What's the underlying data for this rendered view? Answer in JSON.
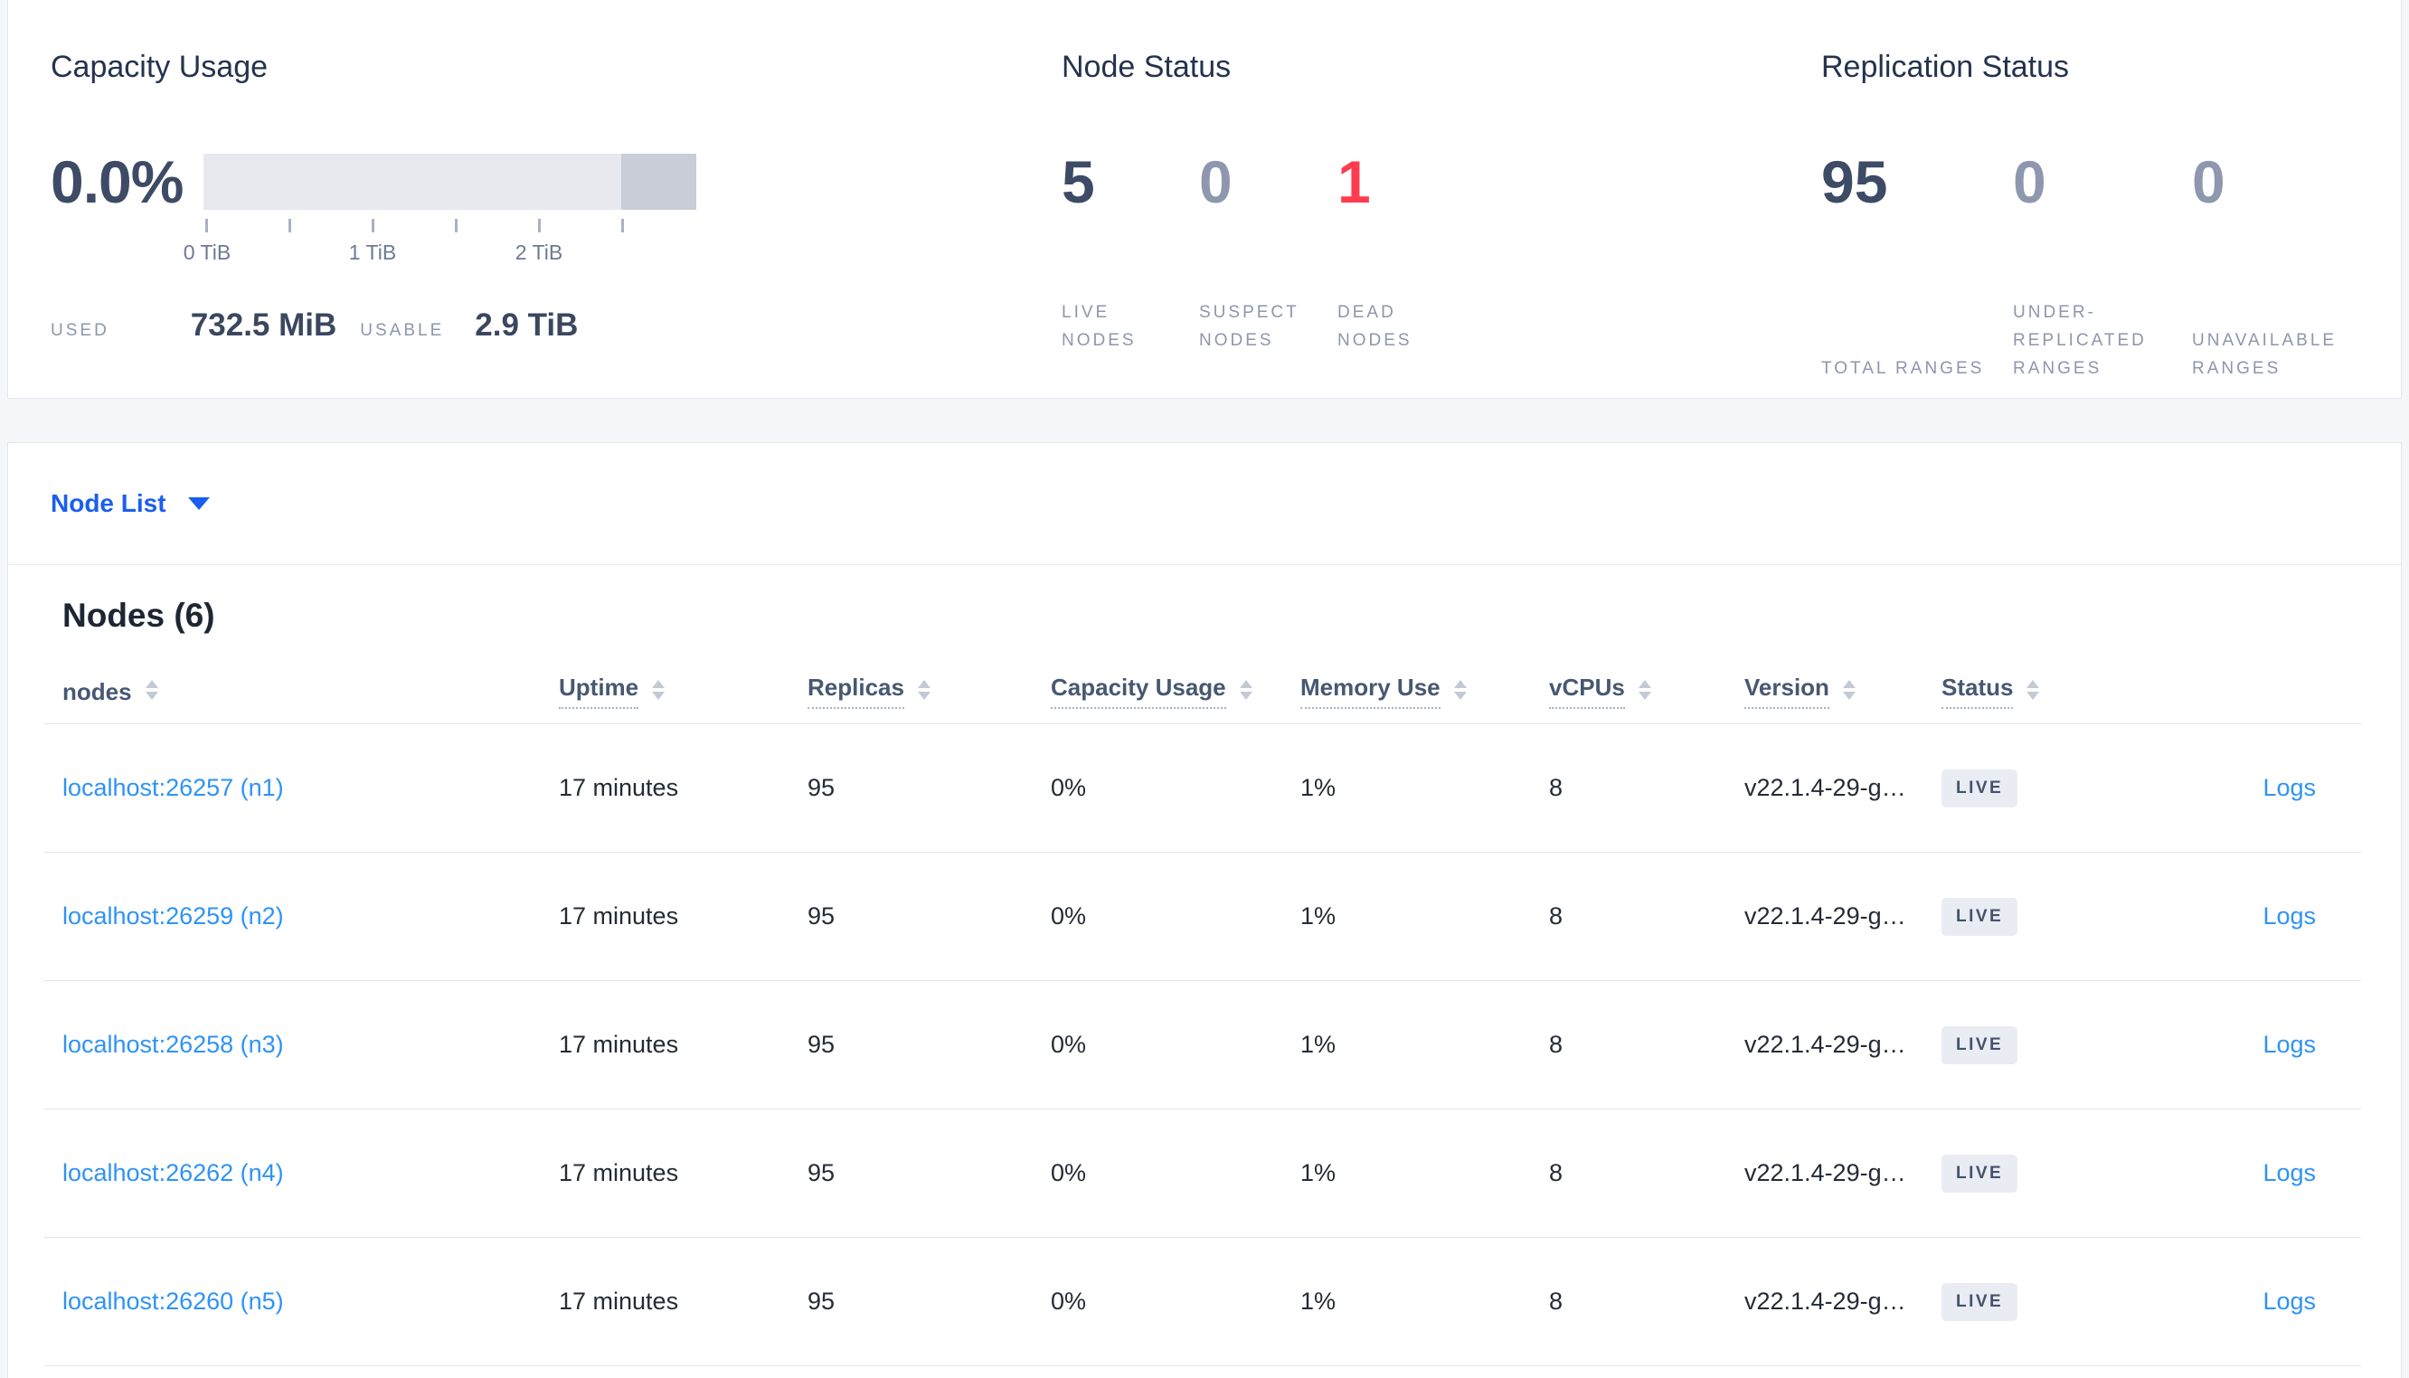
{
  "colors": {
    "page_background": "#f4f6fa",
    "card_background": "#ffffff",
    "accent_blue": "#1a5ef0",
    "link_blue": "#2e93f5",
    "danger_red": "#ff3b4f",
    "stat_dark": "#3e4b66",
    "stat_muted": "#8e97ad",
    "label_gray": "#8d96ac",
    "bar_light": "#e7e9ef",
    "bar_dark": "#c9cdd8"
  },
  "capacity_panel": {
    "title": "Capacity Usage",
    "percent": "0.0%",
    "tick_labels": [
      "0 TiB",
      "1 TiB",
      "2 TiB"
    ],
    "used_label": "USED",
    "used_value": "732.5 MiB",
    "usable_label": "USABLE",
    "usable_value": "2.9 TiB"
  },
  "node_status_panel": {
    "title": "Node Status",
    "live": {
      "value": "5",
      "label": "LIVE NODES"
    },
    "suspect": {
      "value": "0",
      "label": "SUSPECT NODES"
    },
    "dead": {
      "value": "1",
      "label": "DEAD NODES"
    }
  },
  "replication_panel": {
    "title": "Replication Status",
    "total": {
      "value": "95",
      "label": "TOTAL RANGES"
    },
    "under_replicated": {
      "value": "0",
      "label": "UNDER-REPLICATED RANGES"
    },
    "unavailable": {
      "value": "0",
      "label": "UNAVAILABLE RANGES"
    }
  },
  "view_selector": {
    "label": "Node List"
  },
  "nodes_section": {
    "title": "Nodes (6)",
    "columns": [
      "nodes",
      "Uptime",
      "Replicas",
      "Capacity Usage",
      "Memory Use",
      "vCPUs",
      "Version",
      "Status"
    ],
    "logs_label": "Logs",
    "rows": [
      {
        "address": "localhost:26257 (n1)",
        "uptime": "17 minutes",
        "replicas": "95",
        "capacity_usage": "0%",
        "memory_use": "1%",
        "vcpus": "8",
        "version": "v22.1.4-29-g…",
        "status": "LIVE"
      },
      {
        "address": "localhost:26259 (n2)",
        "uptime": "17 minutes",
        "replicas": "95",
        "capacity_usage": "0%",
        "memory_use": "1%",
        "vcpus": "8",
        "version": "v22.1.4-29-g…",
        "status": "LIVE"
      },
      {
        "address": "localhost:26258 (n3)",
        "uptime": "17 minutes",
        "replicas": "95",
        "capacity_usage": "0%",
        "memory_use": "1%",
        "vcpus": "8",
        "version": "v22.1.4-29-g…",
        "status": "LIVE"
      },
      {
        "address": "localhost:26262 (n4)",
        "uptime": "17 minutes",
        "replicas": "95",
        "capacity_usage": "0%",
        "memory_use": "1%",
        "vcpus": "8",
        "version": "v22.1.4-29-g…",
        "status": "LIVE"
      },
      {
        "address": "localhost:26260 (n5)",
        "uptime": "17 minutes",
        "replicas": "95",
        "capacity_usage": "0%",
        "memory_use": "1%",
        "vcpus": "8",
        "version": "v22.1.4-29-g…",
        "status": "LIVE"
      }
    ]
  }
}
